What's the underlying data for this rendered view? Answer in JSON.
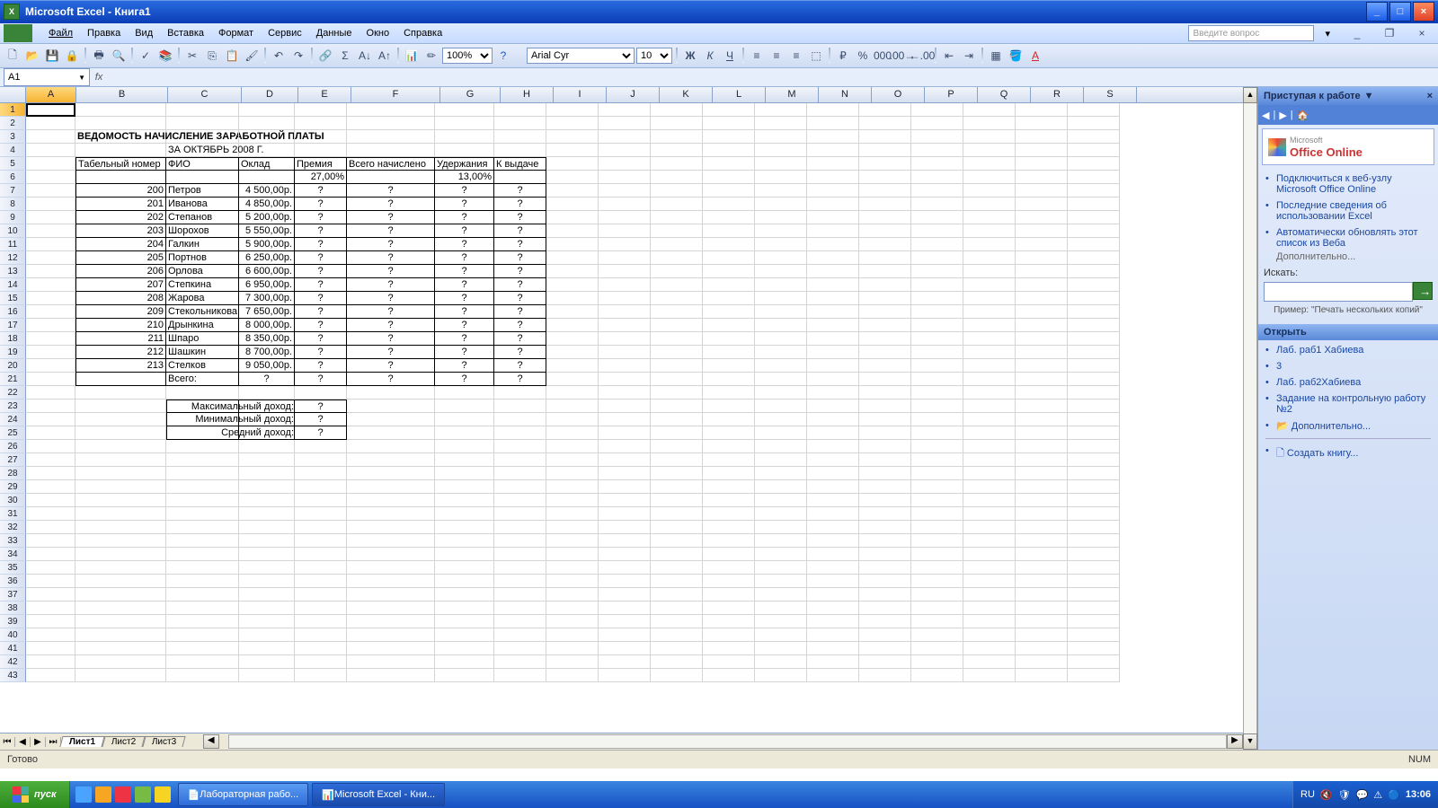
{
  "window": {
    "title_app": "Microsoft Excel",
    "title_doc": "Книга1"
  },
  "menu": {
    "file": "Файл",
    "edit": "Правка",
    "view": "Вид",
    "insert": "Вставка",
    "format": "Формат",
    "tools": "Сервис",
    "data": "Данные",
    "window": "Окно",
    "help": "Справка",
    "question_placeholder": "Введите вопрос"
  },
  "toolbar": {
    "zoom": "100%",
    "font": "Arial Cyr",
    "fontsize": "10"
  },
  "namebox": "A1",
  "columns": [
    "A",
    "B",
    "C",
    "D",
    "E",
    "F",
    "G",
    "H",
    "I",
    "J",
    "K",
    "L",
    "M",
    "N",
    "O",
    "P",
    "Q",
    "R",
    "S"
  ],
  "sheet": {
    "title": "ВЕДОМОСТЬ НАЧИСЛЕНИЕ ЗАРАБОТНОЙ ПЛАТЫ",
    "period": "ЗА ОКТЯБРЬ 2008 Г.",
    "headers": {
      "tab": "Табельный номер",
      "fio": "ФИО",
      "oklad": "Оклад",
      "premia": "Премия",
      "vsego": "Всего начислено",
      "uderzh": "Удержания",
      "vydat": "К выдаче"
    },
    "premia_pct": "27,00%",
    "uderzh_pct": "13,00%",
    "rows": [
      {
        "n": "200",
        "fio": "Петров",
        "oklad": "4 500,00р."
      },
      {
        "n": "201",
        "fio": "Иванова",
        "oklad": "4 850,00р."
      },
      {
        "n": "202",
        "fio": "Степанов",
        "oklad": "5 200,00р."
      },
      {
        "n": "203",
        "fio": "Шорохов",
        "oklad": "5 550,00р."
      },
      {
        "n": "204",
        "fio": "Галкин",
        "oklad": "5 900,00р."
      },
      {
        "n": "205",
        "fio": "Портнов",
        "oklad": "6 250,00р."
      },
      {
        "n": "206",
        "fio": "Орлова",
        "oklad": "6 600,00р."
      },
      {
        "n": "207",
        "fio": "Степкина",
        "oklad": "6 950,00р."
      },
      {
        "n": "208",
        "fio": "Жарова",
        "oklad": "7 300,00р."
      },
      {
        "n": "209",
        "fio": "Стекольникова",
        "oklad": "7 650,00р."
      },
      {
        "n": "210",
        "fio": "Дрынкина",
        "oklad": "8 000,00р."
      },
      {
        "n": "211",
        "fio": "Шпаро",
        "oklad": "8 350,00р."
      },
      {
        "n": "212",
        "fio": "Шашкин",
        "oklad": "8 700,00р."
      },
      {
        "n": "213",
        "fio": "Стелков",
        "oklad": "9 050,00р."
      }
    ],
    "total_label": "Всего:",
    "qmark": "?",
    "stats": {
      "max": "Максимальный доход:",
      "min": "Минимальный доход:",
      "avg": "Средний доход:"
    }
  },
  "tabs": {
    "l1": "Лист1",
    "l2": "Лист2",
    "l3": "Лист3"
  },
  "status": {
    "ready": "Готово",
    "num": "NUM"
  },
  "taskpane": {
    "title": "Приступая к работе",
    "office": "Office Online",
    "office_brand": "Microsoft",
    "links": [
      "Подключиться к веб-узлу Microsoft Office Online",
      "Последние сведения об использовании Excel",
      "Автоматически обновлять этот список из Веба"
    ],
    "more": "Дополнительно...",
    "search_label": "Искать:",
    "search_hint": "Пример: \"Печать нескольких копий\"",
    "open_title": "Открыть",
    "recent": [
      "Лаб. раб1 Хабиева",
      "3",
      "Лаб. раб2Хабиева",
      "Задание на контрольную работу №2"
    ],
    "more2": "Дополнительно...",
    "create": "Создать книгу..."
  },
  "taskbar": {
    "start": "пуск",
    "task1": "Лабораторная рабо...",
    "task2": "Microsoft Excel - Кни...",
    "lang": "RU",
    "time": "13:06"
  },
  "chart_data": {
    "type": "table",
    "title": "ВЕДОМОСТЬ НАЧИСЛЕНИЕ ЗАРАБОТНОЙ ПЛАТЫ — ЗА ОКТЯБРЬ 2008 Г.",
    "columns": [
      "Табельный номер",
      "ФИО",
      "Оклад",
      "Премия",
      "Всего начислено",
      "Удержания",
      "К выдаче"
    ],
    "premia_pct": 27.0,
    "uderzh_pct": 13.0,
    "rows": [
      [
        200,
        "Петров",
        4500.0,
        "?",
        "?",
        "?",
        "?"
      ],
      [
        201,
        "Иванова",
        4850.0,
        "?",
        "?",
        "?",
        "?"
      ],
      [
        202,
        "Степанов",
        5200.0,
        "?",
        "?",
        "?",
        "?"
      ],
      [
        203,
        "Шорохов",
        5550.0,
        "?",
        "?",
        "?",
        "?"
      ],
      [
        204,
        "Галкин",
        5900.0,
        "?",
        "?",
        "?",
        "?"
      ],
      [
        205,
        "Портнов",
        6250.0,
        "?",
        "?",
        "?",
        "?"
      ],
      [
        206,
        "Орлова",
        6600.0,
        "?",
        "?",
        "?",
        "?"
      ],
      [
        207,
        "Степкина",
        6950.0,
        "?",
        "?",
        "?",
        "?"
      ],
      [
        208,
        "Жарова",
        7300.0,
        "?",
        "?",
        "?",
        "?"
      ],
      [
        209,
        "Стекольникова",
        7650.0,
        "?",
        "?",
        "?",
        "?"
      ],
      [
        210,
        "Дрынкина",
        8000.0,
        "?",
        "?",
        "?",
        "?"
      ],
      [
        211,
        "Шпаро",
        8350.0,
        "?",
        "?",
        "?",
        "?"
      ],
      [
        212,
        "Шашкин",
        8700.0,
        "?",
        "?",
        "?",
        "?"
      ],
      [
        213,
        "Стелков",
        9050.0,
        "?",
        "?",
        "?",
        "?"
      ]
    ],
    "totals": {
      "Оклад": "?",
      "Премия": "?",
      "Всего начислено": "?",
      "Удержания": "?",
      "К выдаче": "?"
    },
    "stats": {
      "Максимальный доход": "?",
      "Минимальный доход": "?",
      "Средний доход": "?"
    }
  }
}
